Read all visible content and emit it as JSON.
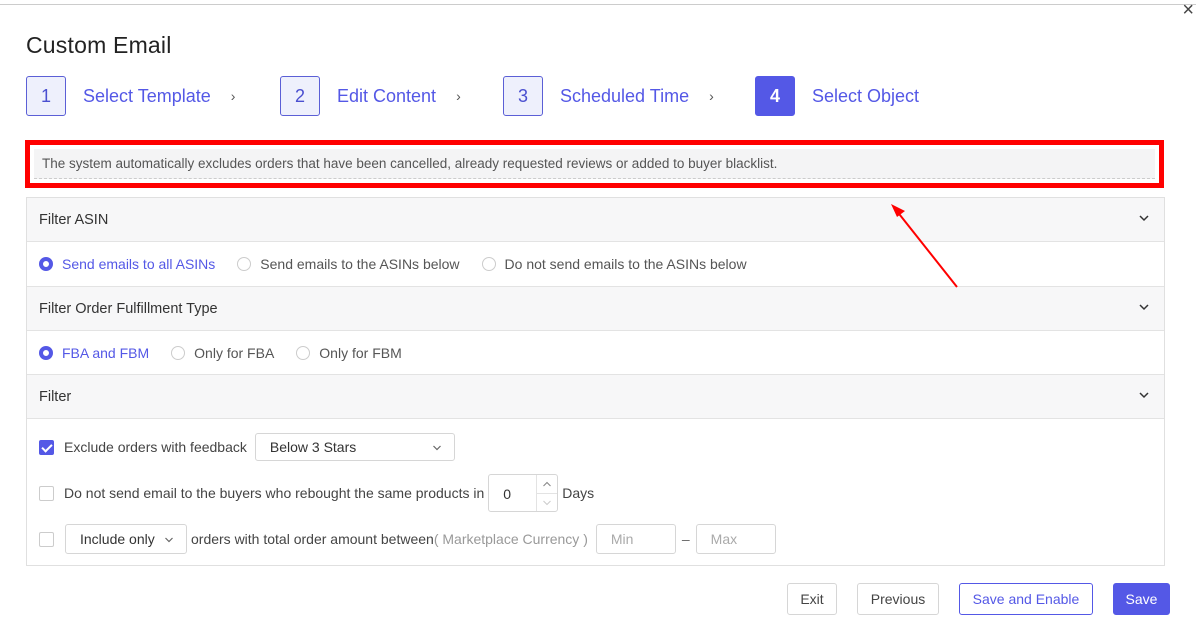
{
  "dialog": {
    "title": "Custom Email",
    "close_glyph": "×"
  },
  "steps": [
    {
      "num": "1",
      "label": "Select Template"
    },
    {
      "num": "2",
      "label": "Edit Content"
    },
    {
      "num": "3",
      "label": "Scheduled Time"
    },
    {
      "num": "4",
      "label": "Select Object"
    }
  ],
  "step_separator": "›",
  "notice": "The system automatically excludes orders that have been cancelled, already requested reviews or added to buyer blacklist.",
  "sections": {
    "asin": {
      "title": "Filter ASIN",
      "options": [
        "Send emails to all ASINs",
        "Send emails to the ASINs below",
        "Do not send emails to the ASINs below"
      ],
      "selected": 0
    },
    "fulfillment": {
      "title": "Filter Order Fulfillment Type",
      "options": [
        "FBA and FBM",
        "Only for FBA",
        "Only for FBM"
      ],
      "selected": 0
    },
    "filter": {
      "title": "Filter",
      "feedback": {
        "checked": true,
        "label": "Exclude orders with feedback",
        "select_value": "Below 3 Stars"
      },
      "rebought": {
        "checked": false,
        "label": "Do not send email to the buyers who rebought the same products in",
        "value": "0",
        "unit": "Days"
      },
      "amount": {
        "checked": false,
        "select_value": "Include only",
        "label": "orders with total order amount between",
        "currency_note": "( Marketplace Currency )",
        "min_placeholder": "Min",
        "separator": "–",
        "max_placeholder": "Max"
      }
    }
  },
  "buttons": {
    "exit": "Exit",
    "previous": "Previous",
    "save_enable": "Save and Enable",
    "save": "Save"
  },
  "colors": {
    "accent": "#5458e6",
    "highlight_box": "#ff0000"
  },
  "icons": {
    "step_separator": "chevron-right-icon",
    "section_toggle": "chevron-down-icon",
    "dropdown": "chevron-down-icon",
    "close": "close-icon",
    "annotation": "annotation-arrow"
  }
}
